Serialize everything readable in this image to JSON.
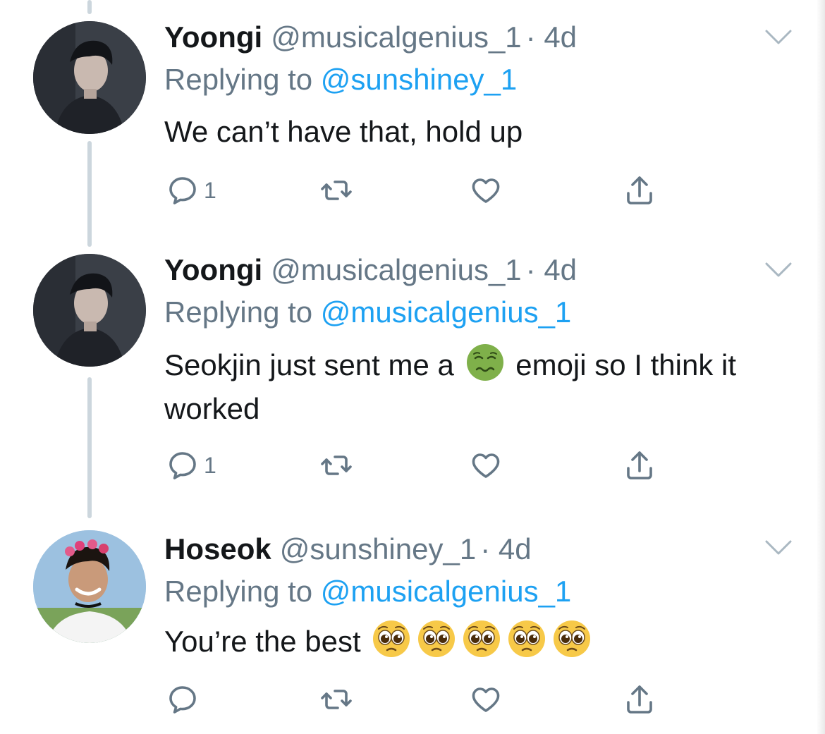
{
  "tweets": [
    {
      "name": "Yoongi",
      "handle": "@musicalgenius_1",
      "time_label": "· 4d",
      "reply_prefix": "Replying to",
      "reply_to": "@sunshiney_1",
      "text": "We can’t have that, hold up",
      "reply_count": "1"
    },
    {
      "name": "Yoongi",
      "handle": "@musicalgenius_1",
      "time_label": "· 4d",
      "reply_prefix": "Replying to",
      "reply_to": "@musicalgenius_1",
      "text_before": "Seokjin just sent me a",
      "emoji": "nauseated-face-emoji",
      "text_after": "emoji so I think it worked",
      "reply_count": "1"
    },
    {
      "name": "Hoseok",
      "handle": "@sunshiney_1",
      "time_label": "· 4d",
      "reply_prefix": "Replying to",
      "reply_to": "@musicalgenius_1",
      "text": "You’re the best",
      "emojis": [
        "pleading-face-emoji",
        "pleading-face-emoji",
        "pleading-face-emoji",
        "pleading-face-emoji",
        "pleading-face-emoji"
      ],
      "reply_count": ""
    }
  ],
  "colors": {
    "text": "#14171a",
    "secondary": "#657786",
    "link": "#1da1f2",
    "thread_line": "#ccd6dd"
  },
  "icons": [
    "reply-icon",
    "retweet-icon",
    "like-icon",
    "share-icon",
    "chevron-down-icon"
  ]
}
